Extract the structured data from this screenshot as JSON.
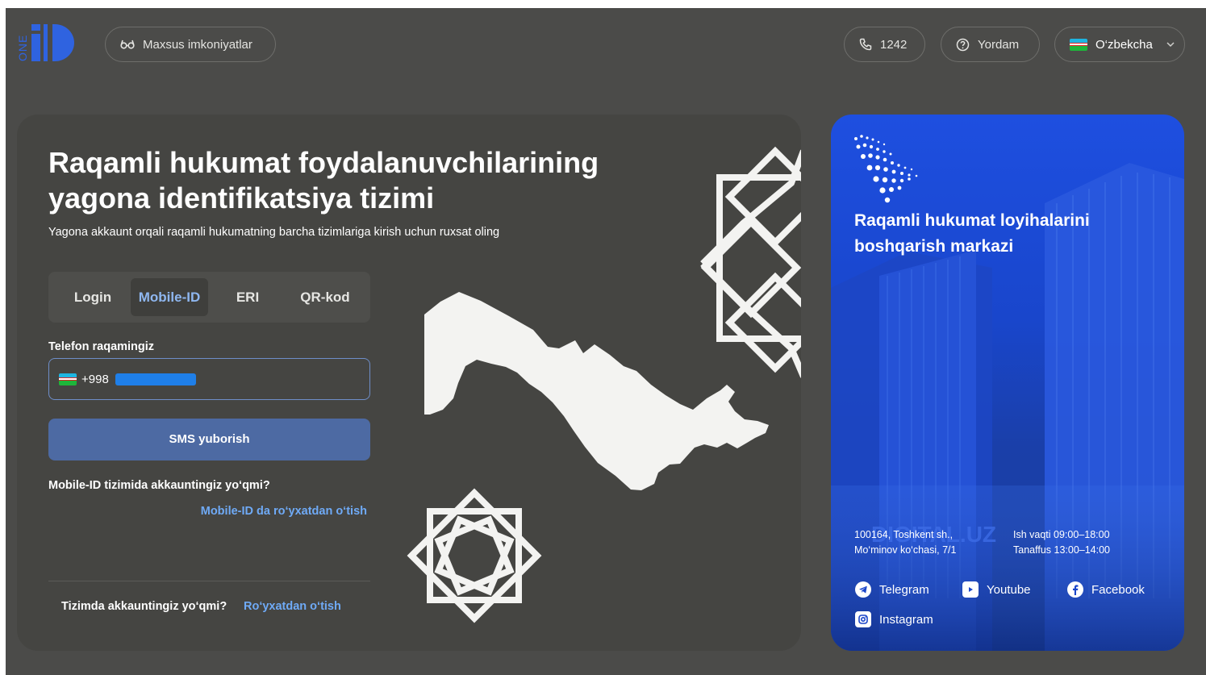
{
  "header": {
    "logo_text": "ONE ID",
    "accessibility_label": "Maxsus imkoniyatlar",
    "phone_label": "1242",
    "help_label": "Yordam",
    "language_label": "O‘zbekcha"
  },
  "login": {
    "title": "Raqamli hukumat foydalanuvchilarining yagona identifikatsiya tizimi",
    "subtitle": "Yagona akkaunt orqali raqamli hukumatning barcha tizimlariga kirish uchun ruxsat oling",
    "tabs": [
      {
        "label": "Login",
        "active": false
      },
      {
        "label": "Mobile-ID",
        "active": true
      },
      {
        "label": "ERI",
        "active": false
      },
      {
        "label": "QR-kod",
        "active": false
      }
    ],
    "phone_label": "Telefon raqamingiz",
    "phone_prefix": "+998",
    "submit_label": "SMS yuborish",
    "mobile_id_question": "Mobile-ID tizimida akkauntingiz yo‘qmi?",
    "mobile_id_register_link": "Mobile-ID da ro‘yxatdan o‘tish",
    "account_question": "Tizimda akkauntingiz yo‘qmi?",
    "register_link": "Ro‘yxatdan o‘tish"
  },
  "info_card": {
    "title": "Raqamli hukumat loyihalarini boshqarish markazi",
    "address_line1": "100164, Toshkent sh.,",
    "address_line2": "Mo‘minov ko‘chasi, 7/1",
    "hours_line1": "Ish vaqti 09:00–18:00",
    "hours_line2": "Tanaffus 13:00–14:00",
    "building_sign": "DIGITAL.UZ",
    "socials": [
      {
        "label": "Telegram",
        "icon": "telegram-icon"
      },
      {
        "label": "Youtube",
        "icon": "youtube-icon"
      },
      {
        "label": "Facebook",
        "icon": "facebook-icon"
      },
      {
        "label": "Instagram",
        "icon": "instagram-icon"
      }
    ]
  },
  "colors": {
    "page_bg": "#4b4b49",
    "card_bg": "#454542",
    "accent_blue": "#4d6aa3",
    "link_blue": "#6faaf6",
    "info_card_blue": "#1e4fe0"
  }
}
